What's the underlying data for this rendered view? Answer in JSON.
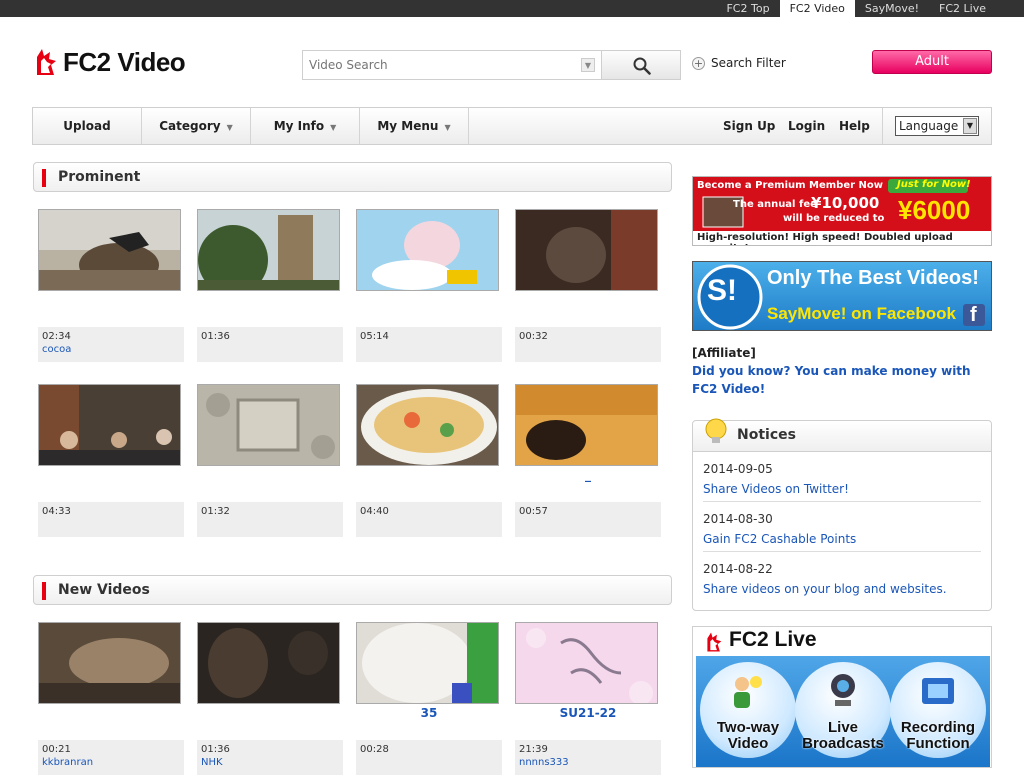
{
  "top_links": [
    {
      "label": "FC2 Top",
      "active": false
    },
    {
      "label": "FC2 Video",
      "active": true
    },
    {
      "label": "SayMove!",
      "active": false
    },
    {
      "label": "FC2 Live",
      "active": false
    }
  ],
  "header": {
    "logo_text": "FC2 Video",
    "search_placeholder": "Video Search",
    "search_button_icon": "magnifier-icon",
    "filter_label": "Search Filter",
    "adult_label": "Adult"
  },
  "nav": {
    "upload": "Upload",
    "category": "Category",
    "my_info": "My Info",
    "my_menu": "My Menu",
    "sign_up": "Sign Up",
    "login": "Login",
    "help": "Help",
    "language": "Language"
  },
  "sections": {
    "prominent": "Prominent",
    "new_videos": "New Videos"
  },
  "prominent_videos": [
    {
      "title": "",
      "duration": "02:34",
      "user": "cocoa"
    },
    {
      "title": "",
      "duration": "01:36",
      "user": ""
    },
    {
      "title": "",
      "duration": "05:14",
      "user": ""
    },
    {
      "title": "",
      "duration": "00:32",
      "user": ""
    },
    {
      "title": "",
      "duration": "04:33",
      "user": ""
    },
    {
      "title": "",
      "duration": "01:32",
      "user": ""
    },
    {
      "title": "",
      "duration": "04:40",
      "user": ""
    },
    {
      "title": "_",
      "duration": "00:57",
      "user": ""
    }
  ],
  "new_videos": [
    {
      "title": "",
      "duration": "00:21",
      "user": "kkbranran"
    },
    {
      "title": "",
      "duration": "01:36",
      "user": "NHK"
    },
    {
      "title": "35",
      "duration": "00:28",
      "user": ""
    },
    {
      "title": "SU21-22",
      "duration": "21:39",
      "user": "nnnns333"
    }
  ],
  "sidebar": {
    "premium_ad": {
      "line1": "Become a Premium Member Now",
      "badge": "Just for Now!",
      "line2": "The annual fee",
      "old_price": "¥10,000",
      "line3": "will be reduced to",
      "new_price": "¥6000",
      "line4": "High-resolution! High speed! Doubled upload capacity!"
    },
    "saymove_ad": {
      "logo": "S!",
      "line1": "Only The Best Videos!",
      "line2": "SayMove! on Facebook"
    },
    "affiliate_label": "[Affiliate]",
    "affiliate_link": "Did you know? You can make money with FC2 Video!",
    "notices_title": "Notices",
    "notices": [
      {
        "date": "2014-09-05",
        "text": "Share Videos on Twitter!"
      },
      {
        "date": "2014-08-30",
        "text": "Gain FC2 Cashable Points"
      },
      {
        "date": "2014-08-22",
        "text": "Share videos on your blog and websites."
      }
    ],
    "live": {
      "title": "FC2 Live",
      "features": [
        "Two-way Video",
        "Live Broadcasts",
        "Recording Function"
      ]
    }
  },
  "colors": {
    "accent_red": "#e60012",
    "link_blue": "#1a56b8",
    "adult_pink": "#ff2d84"
  }
}
